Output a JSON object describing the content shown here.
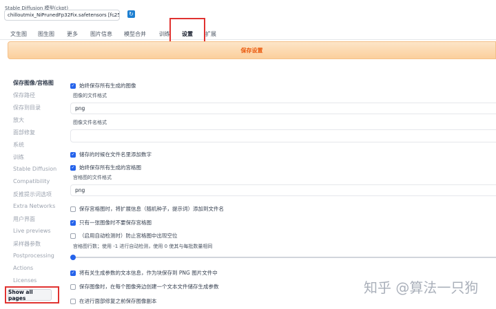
{
  "model": {
    "label": "Stable Diffusion 模型(ckpt)",
    "selected": "chilloutmix_NiPrunedFp32Fix.safetensors [fc251",
    "refresh_icon": "refresh-icon"
  },
  "tabs": [
    {
      "label": "文生图"
    },
    {
      "label": "图生图"
    },
    {
      "label": "更多"
    },
    {
      "label": "图片信息"
    },
    {
      "label": "模型合并"
    },
    {
      "label": "训练"
    },
    {
      "label": "设置",
      "active": true
    },
    {
      "label": "扩展"
    }
  ],
  "save_button": "保存设置",
  "sidebar": {
    "items": [
      {
        "label": "保存图像/宫格图",
        "active": true
      },
      {
        "label": "保存路径"
      },
      {
        "label": "保存到目录"
      },
      {
        "label": "放大"
      },
      {
        "label": "面部修复"
      },
      {
        "label": "系统"
      },
      {
        "label": "训练"
      },
      {
        "label": "Stable Diffusion"
      },
      {
        "label": "Compatibility"
      },
      {
        "label": "反推提示词选项"
      },
      {
        "label": "Extra Networks"
      },
      {
        "label": "用户界面"
      },
      {
        "label": "Live previews"
      },
      {
        "label": "采样器参数"
      },
      {
        "label": "Postprocessing"
      },
      {
        "label": "Actions"
      },
      {
        "label": "Licenses"
      }
    ],
    "show_all": "Show all pages"
  },
  "settings": {
    "always_save_images": {
      "label": "始终保存所有生成的图像",
      "checked": true
    },
    "image_format": {
      "label": "图像的文件格式",
      "value": "png"
    },
    "filename_pattern": {
      "label": "图像文件名格式",
      "value": ""
    },
    "add_number": {
      "label": "储存的时候在文件名里添加数字",
      "checked": true
    },
    "always_save_grid": {
      "label": "始终保存所有生成的宫格图",
      "checked": true
    },
    "grid_format": {
      "label": "宫格图的文件格式",
      "value": "png"
    },
    "grid_extended_filename": {
      "label": "保存宫格图时，将扩展信息（随机种子，提示词）添加到文件名",
      "checked": false
    },
    "grid_only_if_multiple": {
      "label": "只有一张图像时不要保存宫格图",
      "checked": true
    },
    "grid_prevent_empty": {
      "label": "（启用自动检测时）防止宫格图中出现空位",
      "checked": false
    },
    "grid_rows": {
      "label": "宫格图行数；使用 -1 进行自动检测，使用 0 使其与每批数量相同",
      "value": -1
    },
    "save_text_in_png": {
      "label": "将有关生成参数的文本信息，作为块保存到 PNG 图片文件中",
      "checked": true
    },
    "save_txt": {
      "label": "保存图像时，在每个图像旁边创建一个文本文件储存生成参数",
      "checked": false
    },
    "save_before_face_restore": {
      "label": "在进行面部修复之前保存图像副本",
      "checked": false
    }
  },
  "watermark": "知乎 @算法一只狗"
}
